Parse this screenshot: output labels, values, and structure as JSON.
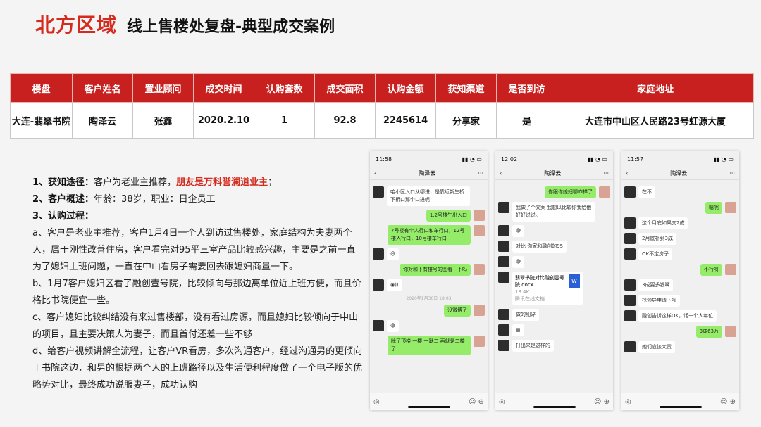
{
  "header": {
    "region": "北方区域",
    "subtitle": "线上售楼处复盘-典型成交案例"
  },
  "table": {
    "columns": [
      "楼盘",
      "客户姓名",
      "置业顾问",
      "成交时间",
      "认购套数",
      "成交面积",
      "认购金额",
      "获知渠道",
      "是否到访",
      "家庭地址"
    ],
    "row": [
      "大连-翡翠书院",
      "陶泽云",
      "张鑫",
      "2020.2.10",
      "1",
      "92.8",
      "2245614",
      "分享家",
      "是",
      "大连市中山区人民路23号虹源大厦"
    ]
  },
  "notes": {
    "l1_label": "1、获知途径：",
    "l1_text": "客户为老业主推荐，",
    "l1_highlight": "朋友是万科誉澜道业主",
    "l1_end": "；",
    "l2_label": "2、客户概述：",
    "l2_text": "年龄：38岁，职业：日企员工",
    "l3_label": "3、认购过程：",
    "a": "a、客户是老业主推荐，客户1月4日一个人到访过售楼处，家庭结构为夫妻两个人，属于刚性改善住房，客户看完对95平三室产品比较感兴趣，主要是之前一直为了媳妇上班问题，一直在中山看房子需要回去跟媳妇商量一下。",
    "b": "b、1月7客户媳妇区看了融创壹号院，比较倾向与那边离单位近上班方便，而且价格比书院便宜一些。",
    "c": "c、客户媳妇比较纠结没有来过售楼部，没有看过房源，而且媳妇比较倾向于中山的项目，且主要决策人为妻子，而且首付还差一些不够",
    "d": "d、给客户视频讲解全流程，让客户VR看房，多次沟通客户，经过沟通男的更倾向于书院这边，和男的根据两个人的上班路径以及生活便利程度做了一个电子版的优略势对比，最终成功说服妻子，成功认购"
  },
  "phones": [
    {
      "time": "11:58",
      "contact": "陶泽云",
      "m1": "咱小区入口从哪进，是靠近新生桥下桥口那个口进呢",
      "m2": "1.2号楼生出入口",
      "m3": "7号楼有个人行口和车行口，12号楼人行口，10号楼车行口",
      "m4": "你对和下有楼号的图看一下吗",
      "stamp": "2020年1月30日 18:03",
      "m5": "没微博了",
      "m6": "除了顶楼 一楼 一跃二 再就是二楼了"
    },
    {
      "time": "12:02",
      "contact": "陶泽云",
      "m1": "你跟你媳妇聊咋样了",
      "m2": "我做了个文案 我想以比较你我给他好好说说。",
      "m3": "对比 你家和融创的95",
      "file_name": "翡翠书院对比融创壹号院.docx",
      "file_size": "18.4K",
      "file_src": "腾讯在线文档",
      "file_icon": "W",
      "m4": "做的细碎",
      "m5": "打出来是这样的"
    },
    {
      "time": "11:57",
      "contact": "陶泽云",
      "m1": "在不",
      "m2": "嗯呢",
      "m3": "这个月底如果交2成",
      "m4": "2月底补到3成",
      "m5": "OK不定房子",
      "m6": "不行呀",
      "m7": "3成要多钱啊",
      "m8": "找领导申请下呗",
      "m9": "融创告诉这样OK，话一个人年位",
      "m10": "3成63万",
      "m11": "她们应该大责"
    }
  ]
}
